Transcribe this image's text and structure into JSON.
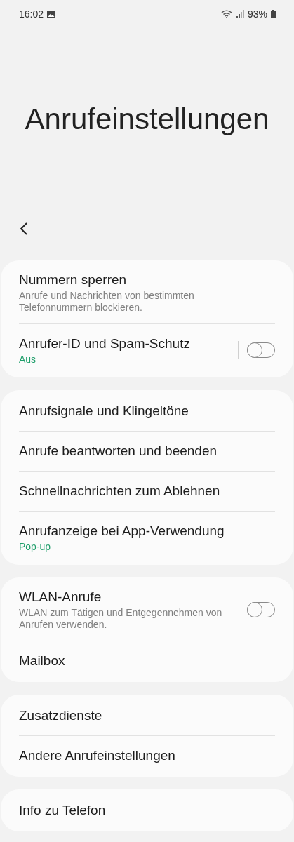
{
  "status_bar": {
    "time": "16:02",
    "battery": "93%"
  },
  "title": "Anrufeinstellungen",
  "groups": [
    {
      "items": [
        {
          "kind": "link",
          "title": "Nummern sperren",
          "subtitle": "Anrufe und Nachrichten von bestimmten Telefonnummern blockieren."
        },
        {
          "kind": "toggle",
          "title": "Anrufer-ID und Spam-Schutz",
          "status": "Aus",
          "on": false,
          "separator": true
        }
      ]
    },
    {
      "items": [
        {
          "kind": "link",
          "title": "Anrufsignale und Klingeltöne"
        },
        {
          "kind": "link",
          "title": "Anrufe beantworten und beenden"
        },
        {
          "kind": "link",
          "title": "Schnellnachrichten zum Ablehnen"
        },
        {
          "kind": "link",
          "title": "Anrufanzeige bei App-Verwendung",
          "status": "Pop-up"
        }
      ]
    },
    {
      "items": [
        {
          "kind": "toggle",
          "title": "WLAN-Anrufe",
          "subtitle": "WLAN zum Tätigen und Entgegennehmen von Anrufen verwenden.",
          "on": false,
          "separator": false
        },
        {
          "kind": "link",
          "title": "Mailbox"
        }
      ]
    },
    {
      "items": [
        {
          "kind": "link",
          "title": "Zusatzdienste"
        },
        {
          "kind": "link",
          "title": "Andere Anrufeinstellungen"
        }
      ]
    },
    {
      "items": [
        {
          "kind": "link",
          "title": "Info zu Telefon"
        }
      ]
    }
  ]
}
